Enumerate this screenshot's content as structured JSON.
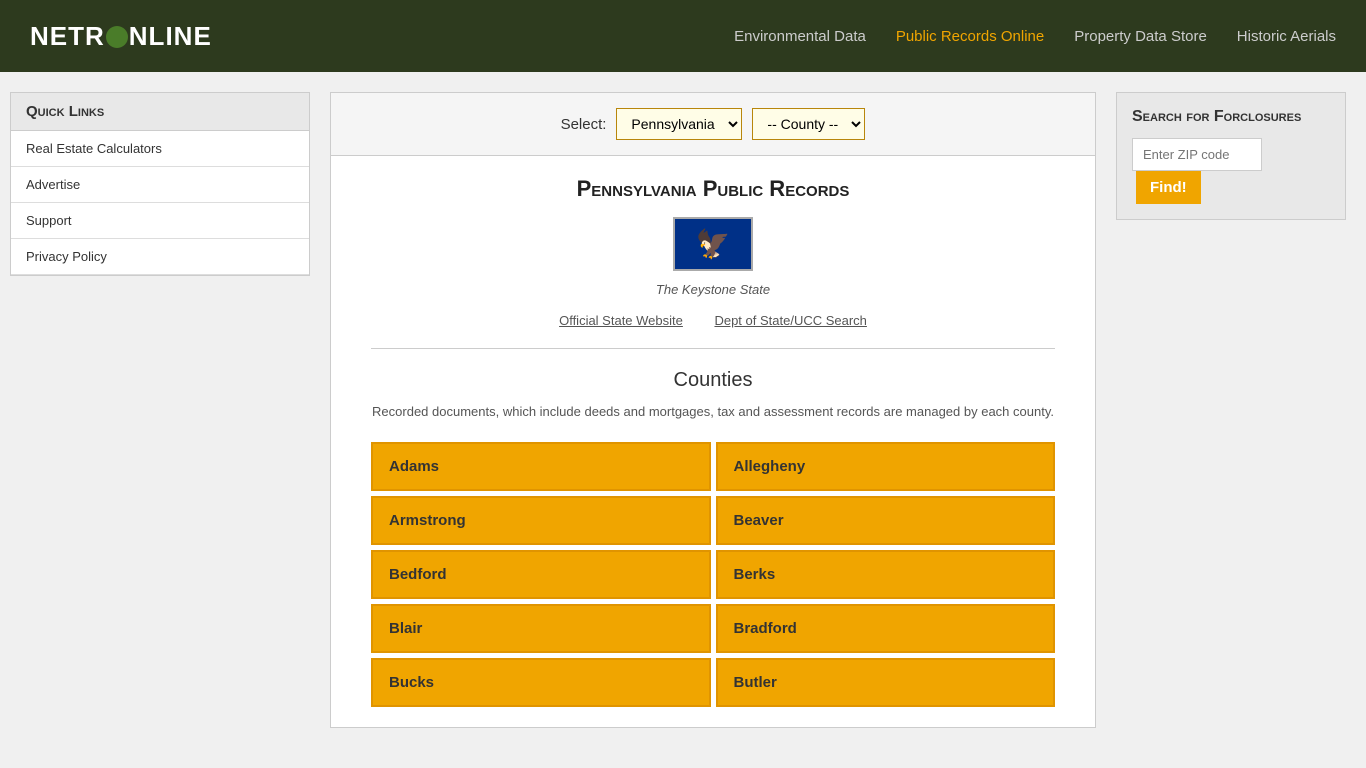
{
  "header": {
    "logo": "NETR◊NLINE",
    "nav": [
      {
        "label": "Environmental Data",
        "active": false
      },
      {
        "label": "Public Records Online",
        "active": true
      },
      {
        "label": "Property Data Store",
        "active": false
      },
      {
        "label": "Historic Aerials",
        "active": false
      }
    ]
  },
  "sidebar": {
    "title": "Quick Links",
    "links": [
      "Real Estate Calculators",
      "Advertise",
      "Support",
      "Privacy Policy"
    ]
  },
  "selector": {
    "label": "Select:",
    "state_value": "Pennsylvania",
    "county_placeholder": "-- County --"
  },
  "main": {
    "title": "Pennsylvania Public Records",
    "state_flag_alt": "Pennsylvania State Flag",
    "nickname": "The Keystone State",
    "official_site_link": "Official State Website",
    "dept_link": "Dept of State/UCC Search",
    "counties_title": "Counties",
    "counties_description": "Recorded documents, which include deeds and mortgages, tax and assessment records are managed by each county.",
    "counties": [
      "Adams",
      "Allegheny",
      "Armstrong",
      "Beaver",
      "Bedford",
      "Berks",
      "Blair",
      "Bradford",
      "Bucks",
      "Butler"
    ]
  },
  "right_panel": {
    "foreclosure_title": "Search for Forclosures",
    "zip_placeholder": "Enter ZIP code",
    "find_label": "Find!"
  }
}
